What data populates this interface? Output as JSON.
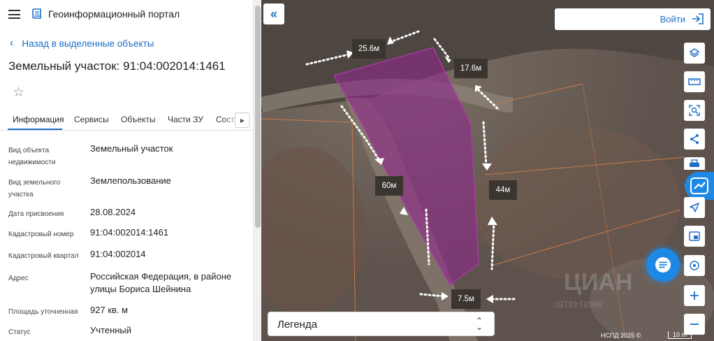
{
  "header": {
    "title": "Геоинформационный портал"
  },
  "nav": {
    "back_label": "Назад в выделенные объекты"
  },
  "parcel": {
    "title": "Земельный участок: 91:04:002014:1461"
  },
  "tabs": [
    {
      "label": "Информация",
      "active": true
    },
    {
      "label": "Сервисы"
    },
    {
      "label": "Объекты"
    },
    {
      "label": "Части ЗУ"
    },
    {
      "label": "Состав ЕЗ"
    }
  ],
  "attributes": [
    {
      "label": "Вид объекта недвижимости",
      "value": "Земельный участок"
    },
    {
      "label": "Вид земельного участка",
      "value": "Землепользование"
    },
    {
      "label": "Дата присвоения",
      "value": "28.08.2024"
    },
    {
      "label": "Кадастровый номер",
      "value": "91:04:002014:1461"
    },
    {
      "label": "Кадастровый квартал",
      "value": "91:04:002014"
    },
    {
      "label": "Адрес",
      "value": "Российская Федерация, в районе улицы Бориса Шейнина"
    },
    {
      "label": "Площадь уточненная",
      "value": "927 кв. м"
    },
    {
      "label": "Статус",
      "value": "Учтенный"
    }
  ],
  "map": {
    "login_label": "Войти",
    "legend_label": "Легенда",
    "distances": [
      "25.6м",
      "17.6м",
      "60м",
      "44м",
      "7.5м"
    ],
    "attribution": "НСПД 2025 ©",
    "scale_label": "10 m",
    "watermark": "ЦИАН",
    "watermark_id": "3868143180",
    "tools": [
      "layers-icon",
      "ruler-icon",
      "search-area-icon",
      "share-icon",
      "print-icon",
      "navigate-icon",
      "screen-icon",
      "location-icon",
      "zoom-in-icon",
      "zoom-out-icon"
    ]
  },
  "colors": {
    "accent": "#1e6fc8",
    "parcel_fill": "#8e2a8a",
    "label_bg": "#3b3530"
  }
}
